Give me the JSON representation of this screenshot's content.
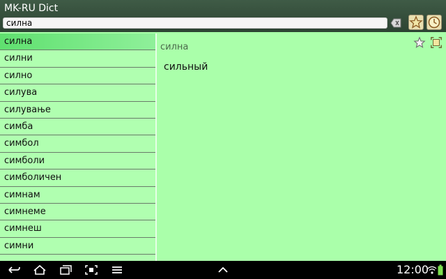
{
  "app": {
    "title": "MK-RU Dict"
  },
  "search": {
    "value": "силна"
  },
  "icons": {
    "clear": "backspace-clear-icon",
    "favorites": "star-favorites-icon",
    "history": "clock-history-icon",
    "add_favorite": "star-outline-icon",
    "fullscreen": "expand-icon"
  },
  "list": {
    "items": [
      {
        "label": "силна",
        "selected": true
      },
      {
        "label": "силни"
      },
      {
        "label": "силно"
      },
      {
        "label": "силува"
      },
      {
        "label": "силување"
      },
      {
        "label": "симба"
      },
      {
        "label": "симбол"
      },
      {
        "label": "симболи"
      },
      {
        "label": "симболичен"
      },
      {
        "label": "симнам"
      },
      {
        "label": "симнеме"
      },
      {
        "label": "симнеш"
      },
      {
        "label": "симни"
      }
    ]
  },
  "detail": {
    "headword": "силна",
    "translation": "сильный"
  },
  "status": {
    "time": "12:00"
  },
  "colors": {
    "header": "#34503b",
    "list_bg": "#b0ffb0",
    "selected": "#6ce37a",
    "detail_bg": "#aaffaa"
  }
}
